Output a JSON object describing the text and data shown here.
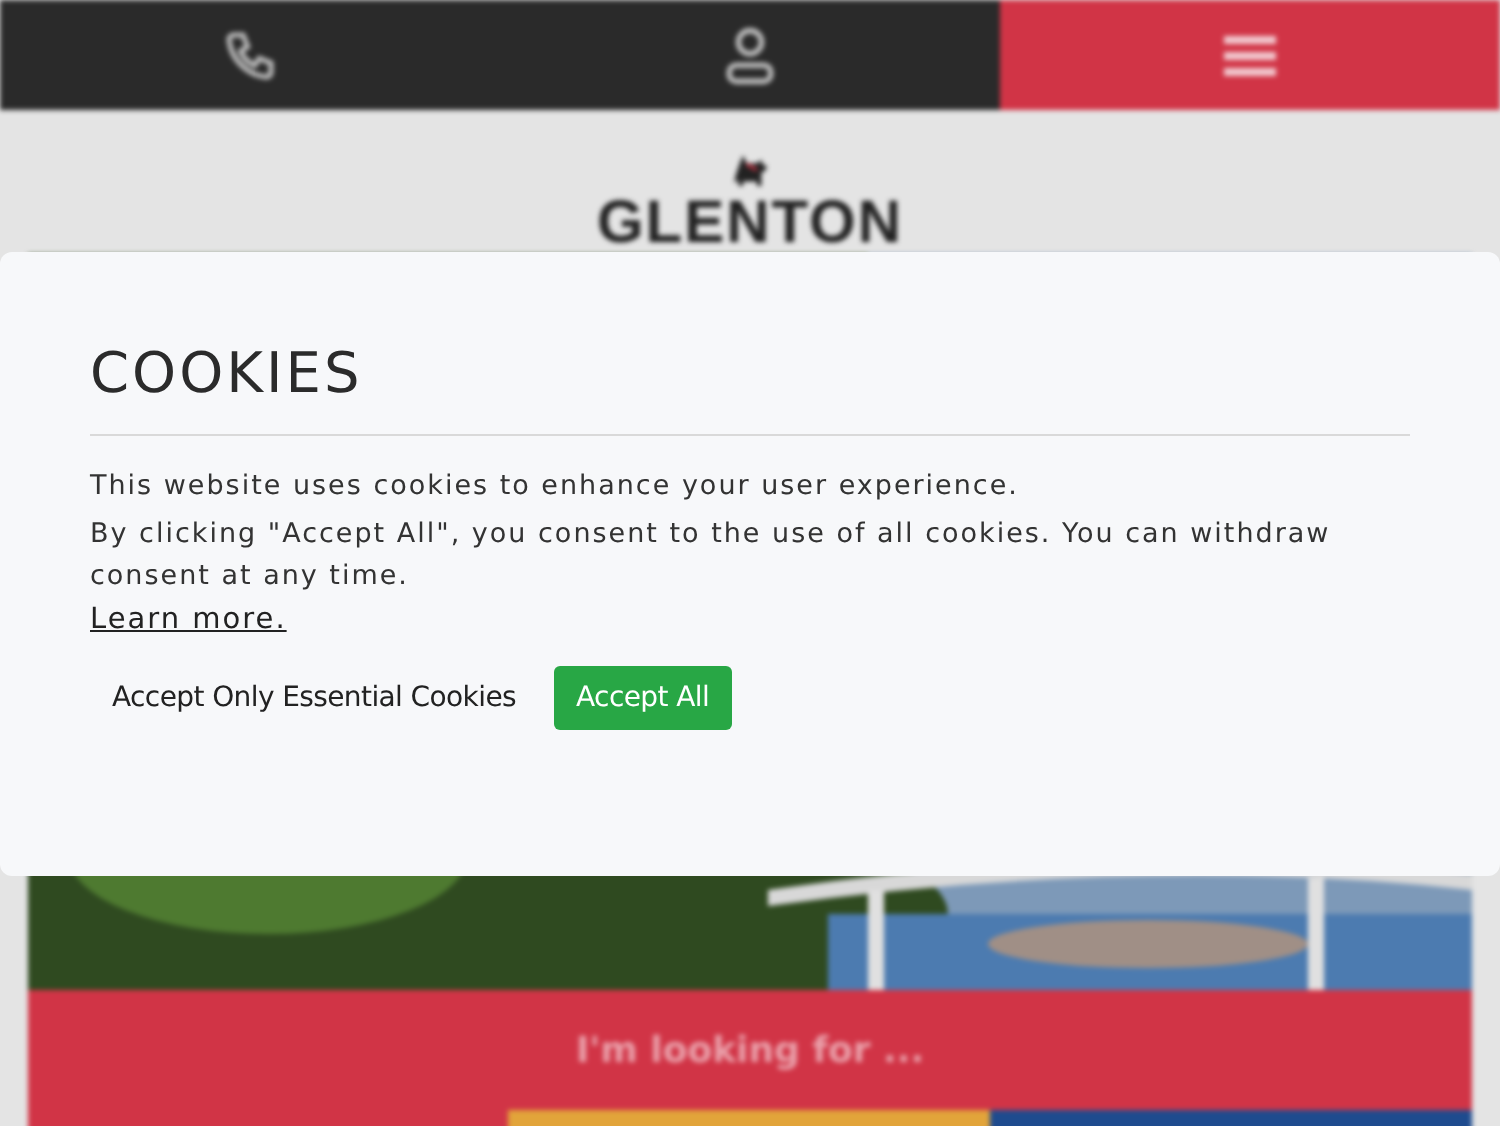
{
  "header": {
    "brand": "GLENTON"
  },
  "search_panel": {
    "title": "I'm looking for ..."
  },
  "cookie_dialog": {
    "title": "COOKIES",
    "paragraphs": [
      "This website uses cookies to enhance your user experience.",
      "By clicking \"Accept All\", you consent to the use of all cookies. You can withdraw consent at any time."
    ],
    "link": "Learn more.",
    "buttons": [
      {
        "label": "Accept Only Essential Cookies",
        "kind": "plain"
      },
      {
        "label": "Accept All",
        "kind": "primary"
      }
    ]
  }
}
